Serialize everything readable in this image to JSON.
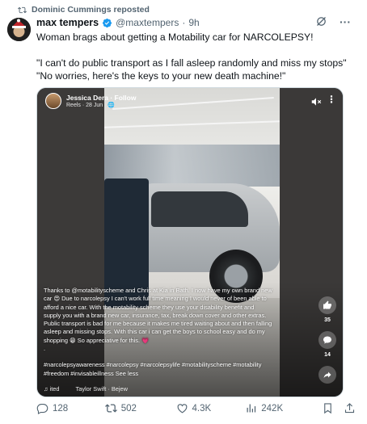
{
  "repost": {
    "text": "Dominic Cummings reposted",
    "icon": "repost-icon"
  },
  "author": {
    "name": "max tempers",
    "handle": "@maxtempers",
    "separator": "·",
    "time": "9h",
    "verified_icon": "verified-badge-icon",
    "verified_color": "#1d9bf0"
  },
  "tweet": {
    "line1": "Woman brags about getting a Motability car for NARCOLEPSY!",
    "line2": "\"I can't do public transport as I fall asleep randomly and miss my stops\"",
    "line3": "\"No worries, here's the keys to your new death machine!\""
  },
  "media": {
    "poster_name": "Jessica Dera · Follow",
    "poster_sub": "Reels · 28 Jun · 🌐",
    "caption": [
      "Thanks to @motabilityscheme and Chris at Kia in Bath. I now have my own brand new",
      "car 😍 Due to narcolepsy I can't work full time meaning I would never of been able to",
      "afford a nice car. With the motability scheme they use your disability benefit and",
      "supply you with a brand new car, insurance, tax, break down cover and other extras.",
      "Public transport is bad for me because it makes me tired waiting about and then falling",
      "asleep and missing stops. With this car i can get the boys to school easy and do my",
      "shopping 😁 So appreciative for this. 💗"
    ],
    "dot": ".",
    "hashtags_line1": "#narcolepsyawareness #narcolepsy #narcolepsylife #motabilityscheme #motability",
    "hashtags_line2": "#freedom #invisableillness See less",
    "footer_left": "♫ ited",
    "footer_music": "Taylor Swift · Bejew",
    "likes_count": "35",
    "comments_count": "14"
  },
  "engagement": {
    "replies": "128",
    "reposts": "502",
    "likes": "4.3K",
    "views": "242K"
  },
  "colors": {
    "text_primary": "#0f1419",
    "text_secondary": "#536471",
    "accent": "#1d9bf0"
  }
}
